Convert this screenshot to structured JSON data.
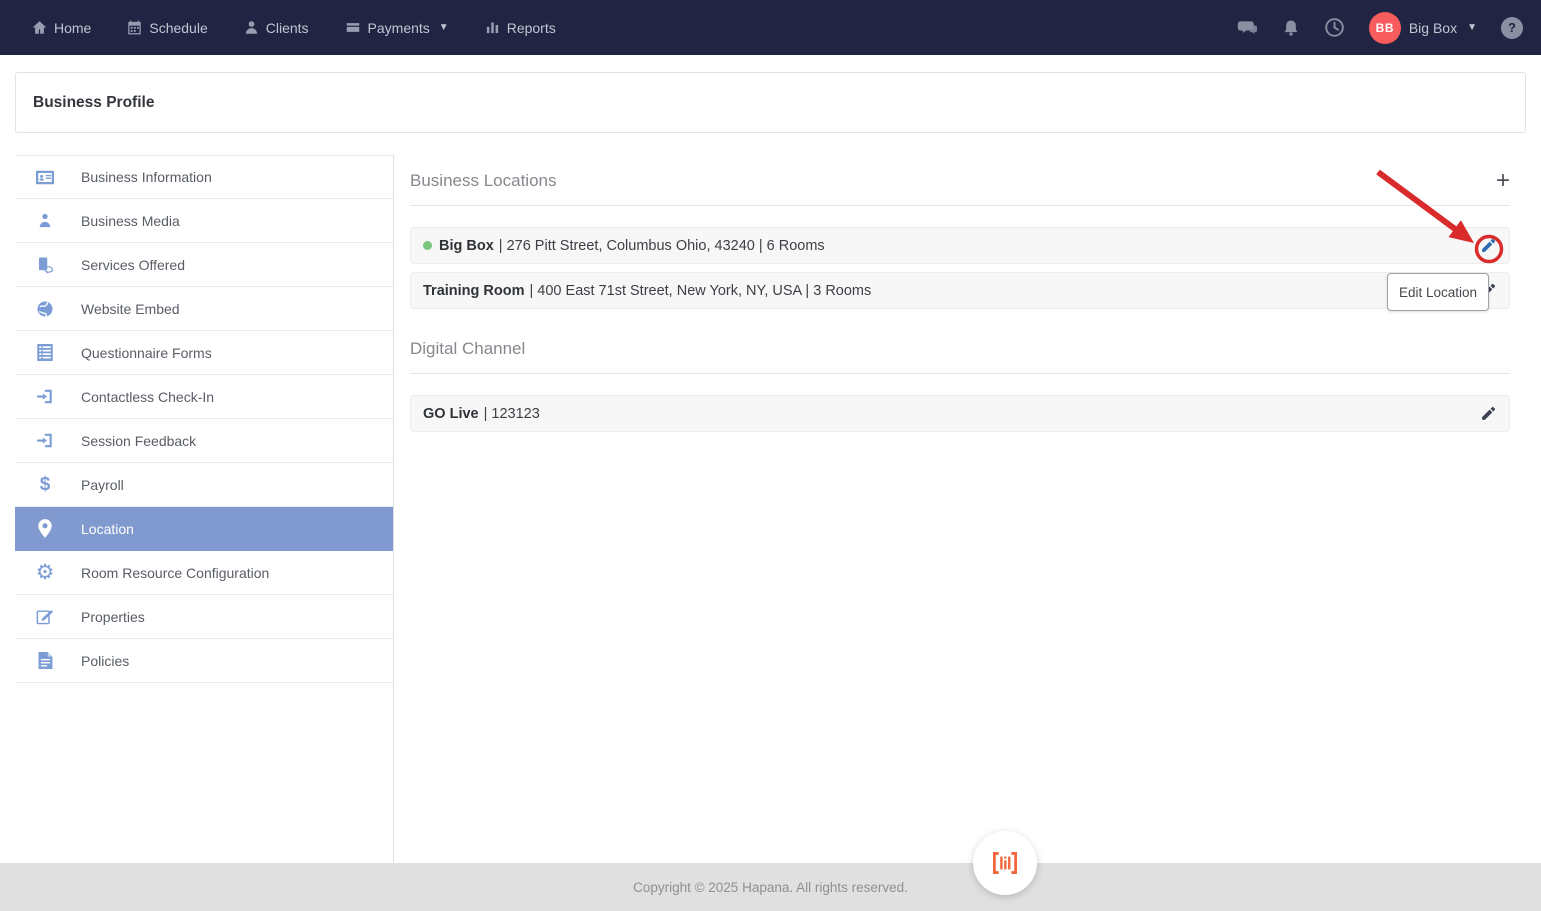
{
  "navbar": {
    "items": [
      {
        "label": "Home",
        "icon": "home-icon"
      },
      {
        "label": "Schedule",
        "icon": "calendar-icon"
      },
      {
        "label": "Clients",
        "icon": "person-icon"
      },
      {
        "label": "Payments",
        "icon": "credit-card-icon",
        "has_dropdown": true
      },
      {
        "label": "Reports",
        "icon": "bar-chart-icon"
      }
    ],
    "user": {
      "initials": "BB",
      "name": "Big Box"
    }
  },
  "page_header": {
    "title": "Business Profile"
  },
  "sidebar": {
    "items": [
      {
        "label": "Business Information",
        "icon": "id-card-icon"
      },
      {
        "label": "Business Media",
        "icon": "person-icon"
      },
      {
        "label": "Services Offered",
        "icon": "services-icon"
      },
      {
        "label": "Website Embed",
        "icon": "globe-icon"
      },
      {
        "label": "Questionnaire Forms",
        "icon": "form-icon"
      },
      {
        "label": "Contactless Check-In",
        "icon": "sign-in-icon"
      },
      {
        "label": "Session Feedback",
        "icon": "sign-in-icon"
      },
      {
        "label": "Payroll",
        "icon": "dollar-icon"
      },
      {
        "label": "Location",
        "icon": "map-pin-icon",
        "active": true
      },
      {
        "label": "Room Resource Configuration",
        "icon": "gear-icon"
      },
      {
        "label": "Properties",
        "icon": "edit-note-icon"
      },
      {
        "label": "Policies",
        "icon": "document-icon"
      }
    ]
  },
  "main": {
    "business_locations": {
      "title": "Business Locations",
      "add_label": "+",
      "rows": [
        {
          "name": "Big Box",
          "details": "| 276 Pitt Street, Columbus Ohio, 43240 | 6 Rooms",
          "status": "active"
        },
        {
          "name": "Training Room",
          "details": "| 400 East 71st Street, New York, NY, USA | 3 Rooms"
        }
      ]
    },
    "digital_channel": {
      "title": "Digital Channel",
      "rows": [
        {
          "name": "GO Live",
          "details": "| 123123"
        }
      ]
    }
  },
  "tooltip": {
    "label": "Edit Location"
  },
  "footer": {
    "copyright": "Copyright © 2025 Hapana. All rights reserved."
  },
  "colors": {
    "navbar_bg": "#212442",
    "accent_blue": "#8099ce",
    "sidebar_icon_blue": "#7b9cd4",
    "avatar_red": "#f85c5c",
    "status_green": "#7cc57d",
    "annotation_red": "#d92b2b",
    "brand_orange": "#f2663c",
    "footer_bg": "#e0e0e0"
  }
}
